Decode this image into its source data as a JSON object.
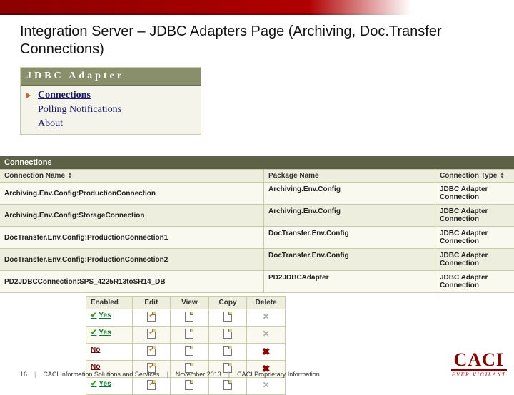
{
  "slide": {
    "title": "Integration Server – JDBC Adapters Page (Archiving, Doc.Transfer Connections)"
  },
  "adapter": {
    "header": "JDBC Adapter",
    "items": [
      {
        "label": "Connections",
        "active": true
      },
      {
        "label": "Polling Notifications",
        "active": false
      },
      {
        "label": "About",
        "active": false
      }
    ]
  },
  "connections": {
    "heading": "Connections",
    "columns": {
      "name": "Connection Name",
      "pkg": "Package Name",
      "type": "Connection Type"
    },
    "rows": [
      {
        "name": "Archiving.Env.Config:ProductionConnection",
        "pkg": "Archiving.Env.Config",
        "type": "JDBC Adapter Connection"
      },
      {
        "name": "Archiving.Env.Config:StorageConnection",
        "pkg": "Archiving.Env.Config",
        "type": "JDBC Adapter Connection"
      },
      {
        "name": "DocTransfer.Env.Config:ProductionConnection1",
        "pkg": "DocTransfer.Env.Config",
        "type": "JDBC Adapter Connection"
      },
      {
        "name": "DocTransfer.Env.Config:ProductionConnection2",
        "pkg": "DocTransfer.Env.Config",
        "type": "JDBC Adapter Connection"
      },
      {
        "name": "PD2JDBCConnection:SPS_4225R13toSR14_DB",
        "pkg": "PD2JDBCAdapter",
        "type": "JDBC Adapter Connection"
      }
    ]
  },
  "actions": {
    "columns": {
      "enabled": "Enabled",
      "edit": "Edit",
      "view": "View",
      "copy": "Copy",
      "del": "Delete"
    },
    "rows": [
      {
        "enabled": "Yes",
        "deletable": false
      },
      {
        "enabled": "Yes",
        "deletable": false
      },
      {
        "enabled": "No",
        "deletable": true
      },
      {
        "enabled": "No",
        "deletable": true
      },
      {
        "enabled": "Yes",
        "deletable": false
      }
    ]
  },
  "footer": {
    "page": "16",
    "org": "CACI Information Solutions and Services",
    "date": "November 2013",
    "conf": "CACI Proprietary Information",
    "logo_main": "CACI",
    "logo_sub": "EVER VIGILANT"
  }
}
